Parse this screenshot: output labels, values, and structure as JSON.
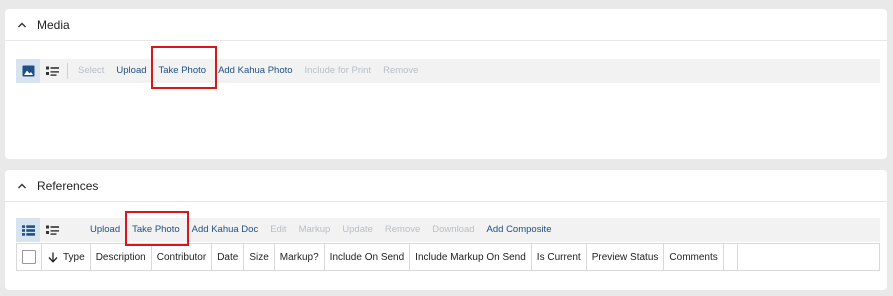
{
  "media": {
    "title": "Media",
    "actions": [
      {
        "label": "Select",
        "enabled": false,
        "name": "select-button"
      },
      {
        "label": "Upload",
        "enabled": true,
        "name": "upload-button"
      },
      {
        "label": "Take Photo",
        "enabled": true,
        "name": "take-photo-button"
      },
      {
        "label": "Add Kahua Photo",
        "enabled": true,
        "name": "add-kahua-photo-button"
      },
      {
        "label": "Include for Print",
        "enabled": false,
        "name": "include-for-print-button"
      },
      {
        "label": "Remove",
        "enabled": false,
        "name": "remove-button"
      }
    ]
  },
  "references": {
    "title": "References",
    "actions": [
      {
        "label": "Upload",
        "enabled": true,
        "name": "upload-button"
      },
      {
        "label": "Take Photo",
        "enabled": true,
        "name": "take-photo-button"
      },
      {
        "label": "Add Kahua Doc",
        "enabled": true,
        "name": "add-kahua-doc-button"
      },
      {
        "label": "Edit",
        "enabled": false,
        "name": "edit-button"
      },
      {
        "label": "Markup",
        "enabled": false,
        "name": "markup-button"
      },
      {
        "label": "Update",
        "enabled": false,
        "name": "update-button"
      },
      {
        "label": "Remove",
        "enabled": false,
        "name": "remove-button"
      },
      {
        "label": "Download",
        "enabled": false,
        "name": "download-button"
      },
      {
        "label": "Add Composite",
        "enabled": true,
        "name": "add-composite-button"
      }
    ],
    "columns": [
      "Type",
      "Description",
      "Contributor",
      "Date",
      "Size",
      "Markup?",
      "Include On Send",
      "Include Markup On Send",
      "Is Current",
      "Preview Status",
      "Comments"
    ]
  },
  "colors": {
    "link": "#1f4f85",
    "disabled": "#b8bfc7",
    "highlight": "#d9161c",
    "active_view": "#d7e3ee",
    "icon": "#1f4f85"
  },
  "icons": [
    "chevron-up-icon",
    "image-view-icon",
    "list-view-icon",
    "grid-list-icon",
    "sort-arrow-down-icon"
  ]
}
